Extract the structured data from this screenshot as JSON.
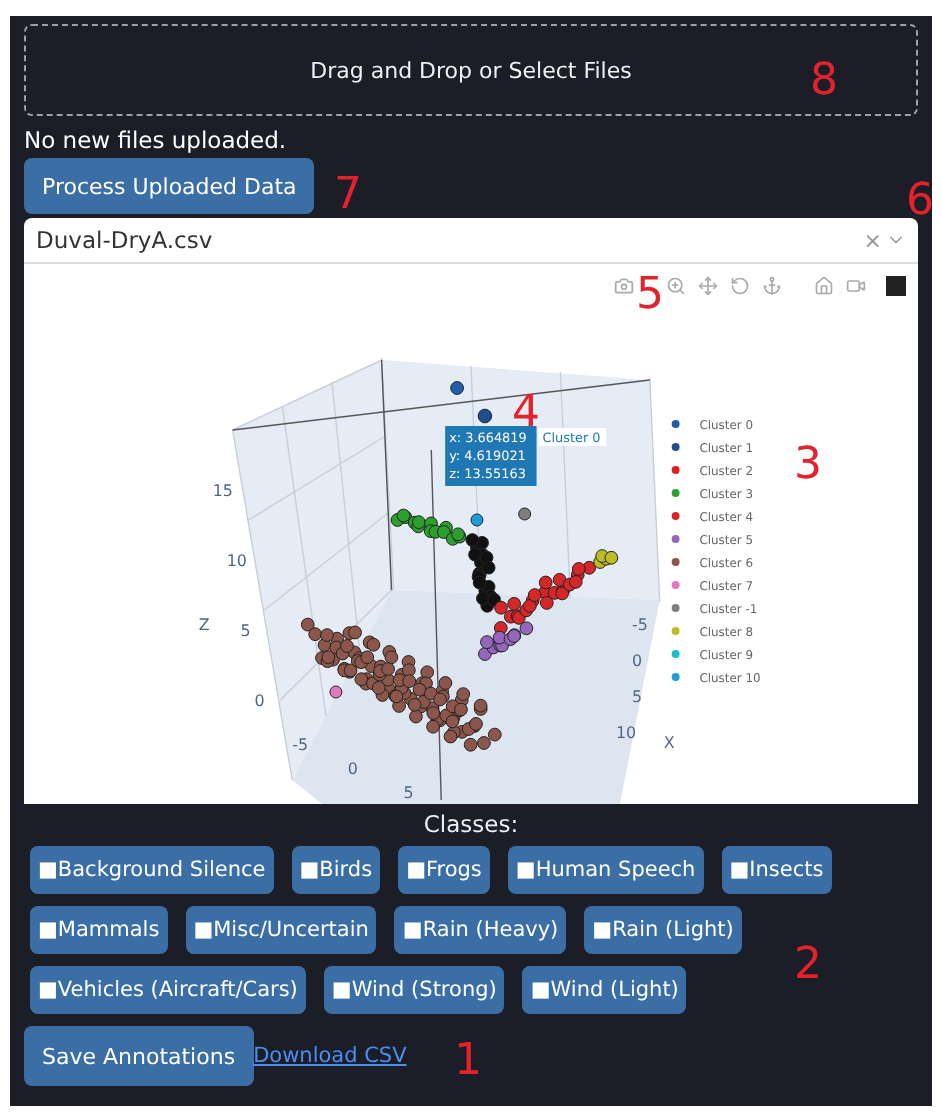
{
  "upload": {
    "label": "Drag and Drop or Select Files"
  },
  "upload_status": "No new files uploaded.",
  "process_button": "Process Uploaded Data",
  "file_select": {
    "value": "Duval-DryA.csv",
    "clear": "×"
  },
  "plot": {
    "tooltip": {
      "lines": [
        "x: 3.664819",
        "y: 4.619021",
        "z: 13.55163"
      ],
      "trace": "Cluster 0"
    },
    "z_ticks": [
      "15",
      "10",
      "5",
      "0"
    ],
    "z_label": "Z",
    "y_ticks": [
      "-5",
      "0",
      "5"
    ],
    "x_ticks": [
      "-5",
      "0",
      "5",
      "10"
    ],
    "x_label": "X",
    "legend": [
      {
        "name": "Cluster 0",
        "color": "#1f5fa8"
      },
      {
        "name": "Cluster 1",
        "color": "#1f4f8f"
      },
      {
        "name": "Cluster 2",
        "color": "#e41a1c"
      },
      {
        "name": "Cluster 3",
        "color": "#2ca02c"
      },
      {
        "name": "Cluster 4",
        "color": "#d62728"
      },
      {
        "name": "Cluster 5",
        "color": "#9467bd"
      },
      {
        "name": "Cluster 6",
        "color": "#8c564b"
      },
      {
        "name": "Cluster 7",
        "color": "#e377c2"
      },
      {
        "name": "Cluster -1",
        "color": "#7f7f7f"
      },
      {
        "name": "Cluster 8",
        "color": "#bcbd22"
      },
      {
        "name": "Cluster 9",
        "color": "#17becf"
      },
      {
        "name": "Cluster 10",
        "color": "#1b9fd6"
      }
    ]
  },
  "classes_title": "Classes:",
  "classes": [
    [
      "■Background Silence",
      "■Birds",
      "■Frogs",
      "■Human Speech",
      "■Insects"
    ],
    [
      "■Mammals",
      "■Misc/Uncertain",
      "■Rain (Heavy)",
      "■Rain (Light)"
    ],
    [
      "■Vehicles (Aircraft/Cars)",
      "■Wind (Strong)",
      "■Wind (Light)"
    ]
  ],
  "save_button": "Save Annotations",
  "download_link": "Download CSV",
  "annotations": [
    "8",
    "7",
    "6",
    "5",
    "4",
    "3",
    "2",
    "1"
  ]
}
